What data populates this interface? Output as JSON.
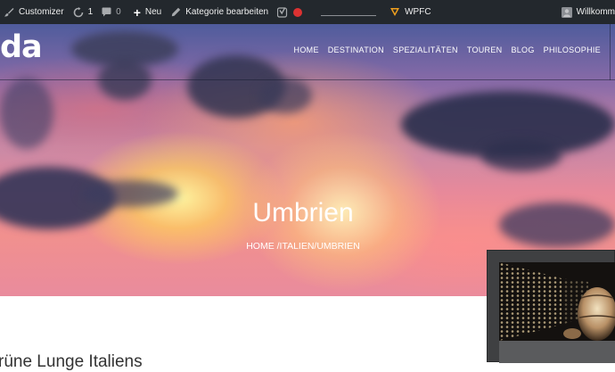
{
  "adminbar": {
    "customizer": "Customizer",
    "updates_count": "1",
    "comments_count": "0",
    "new_label": "Neu",
    "edit_category": "Kategorie bearbeiten",
    "wpfc": "WPFC",
    "welcome": "Willkomm"
  },
  "header": {
    "logo_text": "da",
    "nav": [
      "HOME",
      "DESTINATION",
      "SPEZIALITÄTEN",
      "TOUREN",
      "BLOG",
      "PHILOSOPHIE"
    ]
  },
  "hero": {
    "title": "Umbrien",
    "breadcrumb": "HOME /ITALIEN/UMBRIEN"
  },
  "content": {
    "heading_fragment": "rüne Lunge Italiens"
  },
  "colors": {
    "adminbar_bg": "#23282d",
    "record_dot": "#dc3232",
    "wpfc_icon": "#f0a01e"
  },
  "icons": [
    "customizer-brush-icon",
    "refresh-icon",
    "comment-icon",
    "plus-icon",
    "pencil-icon",
    "yoast-icon",
    "record-icon",
    "wpfc-icon",
    "avatar-icon"
  ]
}
